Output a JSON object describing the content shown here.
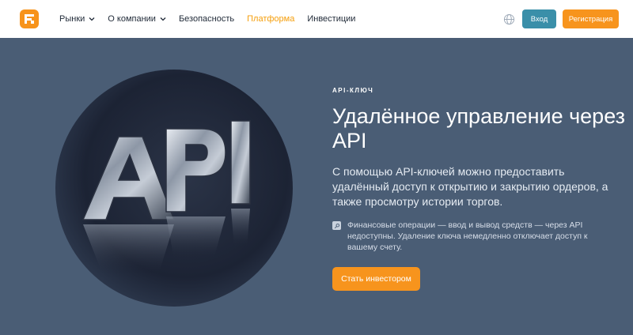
{
  "header": {
    "logo_icon": "brand-logo-icon",
    "nav": [
      {
        "label": "Рынки",
        "has_dropdown": true
      },
      {
        "label": "О компании",
        "has_dropdown": true
      },
      {
        "label": "Безопасность",
        "has_dropdown": false
      },
      {
        "label": "Платформа",
        "has_dropdown": false,
        "active": true
      },
      {
        "label": "Инвестиции",
        "has_dropdown": false
      }
    ],
    "language_icon": "globe-icon",
    "login_label": "Вход",
    "register_label": "Регистрация"
  },
  "hero": {
    "eyebrow": "API-КЛЮЧ",
    "title": "Удалённое управление через API",
    "subtitle": "С помощью API-ключей можно предоставить удалённый доступ к открытию и закрытию ордеров, а также просмотру истории торгов.",
    "note_icon": "key-icon",
    "note": "Финансовые операции — ввод и вывод средств — через API недоступны. Удаление ключа немедленно отключает доступ к вашему счету.",
    "cta_label": "Стать инвестором",
    "art_letters": "API"
  },
  "colors": {
    "accent": "#f7941d",
    "login": "#3a8fa9",
    "background": "#4a5d75",
    "active_nav": "#f59e0b"
  }
}
